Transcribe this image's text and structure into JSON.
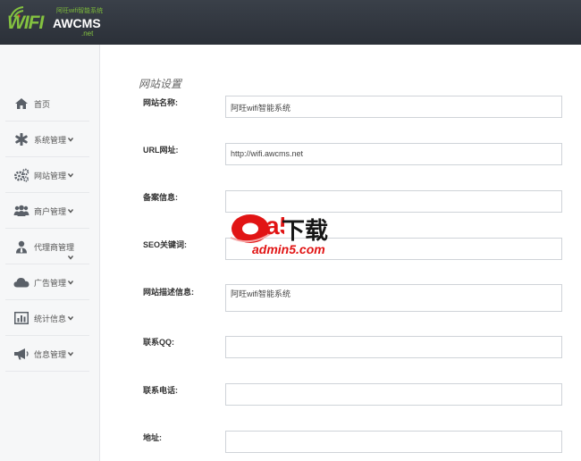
{
  "header": {
    "logo_tagline": "阿旺wifi智能系统",
    "logo_wifi": "WIFI",
    "logo_brand": "AWCMS",
    "logo_net": ".net"
  },
  "sidebar": {
    "items": [
      {
        "label": "首页",
        "icon": "home-icon"
      },
      {
        "label": "系统管理",
        "icon": "asterisk-icon"
      },
      {
        "label": "网站管理",
        "icon": "gears-icon"
      },
      {
        "label": "商户管理",
        "icon": "users-icon"
      },
      {
        "label": "代理商管理",
        "icon": "user-tie-icon"
      },
      {
        "label": "广告管理",
        "icon": "cloud-icon"
      },
      {
        "label": "统计信息",
        "icon": "bar-chart-icon"
      },
      {
        "label": "信息管理",
        "icon": "megaphone-icon"
      }
    ]
  },
  "main": {
    "title": "网站设置",
    "fields": [
      {
        "label": "网站名称:",
        "value": "阿旺wifi智能系统"
      },
      {
        "label": "URL网址:",
        "value": "http://wifi.awcms.net"
      },
      {
        "label": "备案信息:",
        "value": ""
      },
      {
        "label": "SEO关键词:",
        "value": ""
      },
      {
        "label": "网站描述信息:",
        "value": "阿旺wifi智能系统"
      },
      {
        "label": "联系QQ:",
        "value": ""
      },
      {
        "label": "联系电话:",
        "value": ""
      },
      {
        "label": "地址:",
        "value": ""
      }
    ]
  },
  "watermark": {
    "mark": "a5",
    "text": "下载",
    "url": "admin5.com"
  },
  "colors": {
    "header_bg": "#2f343c",
    "logo_green": "#84c240",
    "sidebar_bg": "#f6f7f8",
    "watermark_red": "#e11414"
  }
}
